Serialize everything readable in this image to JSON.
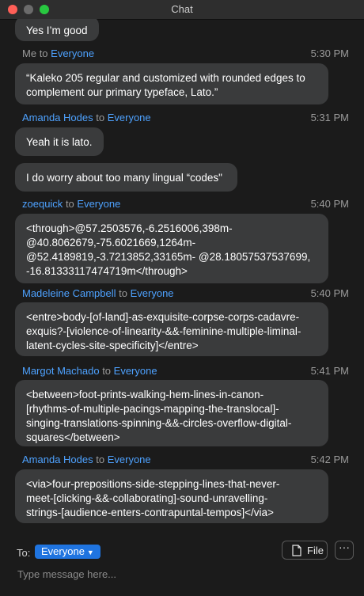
{
  "window": {
    "title": "Chat"
  },
  "messages": [
    {
      "text": "Yes I’m good"
    },
    {
      "sender": "Me",
      "to_word": "to",
      "recipient": "Everyone",
      "time": "5:30 PM",
      "lines": [
        "“Kaleko 205 regular and customized with rounded edges to",
        "complement our primary typeface, Lato.”"
      ]
    },
    {
      "sender": "Amanda Hodes",
      "to_word": "to",
      "recipient": "Everyone",
      "time": "5:31 PM",
      "text": "Yeah it is lato."
    },
    {
      "text": "I do worry about too many lingual “codes\""
    },
    {
      "sender": "zoequick",
      "to_word": "to",
      "recipient": "Everyone",
      "time": "5:40 PM",
      "lines": [
        "<through>@57.2503576,-6.2516006,398m-",
        "@40.8062679,-75.6021669,1264m-",
        "@52.4189819,-3.7213852,33165m- @28.18057537537699,",
        "-16.81333117474719m</through>"
      ]
    },
    {
      "sender": "Madeleine Campbell",
      "to_word": "to",
      "recipient": "Everyone",
      "time": "5:40 PM",
      "lines": [
        "<entre>body-[of-land]-as-exquisite-corpse-corps-cadavre-",
        "exquis?-[violence-of-linearity-&&-feminine-multiple-liminal-",
        "latent-cycles-site-specificity]</entre>"
      ]
    },
    {
      "sender": "Margot Machado",
      "to_word": "to",
      "recipient": "Everyone",
      "time": "5:41 PM",
      "lines": [
        "<between>foot-prints-walking-hem-lines-in-canon-",
        "[rhythms-of-multiple-pacings-mapping-the-translocal]-",
        "singing-translations-spinning-&&-circles-overflow-digital-",
        "squares</between>"
      ]
    },
    {
      "sender": "Amanda Hodes",
      "to_word": "to",
      "recipient": "Everyone",
      "time": "5:42 PM",
      "lines": [
        "<via>four-prepositions-side-stepping-lines-that-never-",
        "meet-[clicking-&&-collaborating]-sound-unravelling-",
        "strings-[audience-enters-contrapuntal-tempos]</via>"
      ]
    }
  ],
  "footer": {
    "to_label": "To:",
    "recipient": "Everyone",
    "file_button": "File",
    "more_button": "···",
    "input_placeholder": "Type message here..."
  },
  "colors": {
    "accent": "#1f74e0",
    "name_blue": "#4ea2ff",
    "bubble": "#3a3b3c",
    "background": "#1b1b1b"
  }
}
